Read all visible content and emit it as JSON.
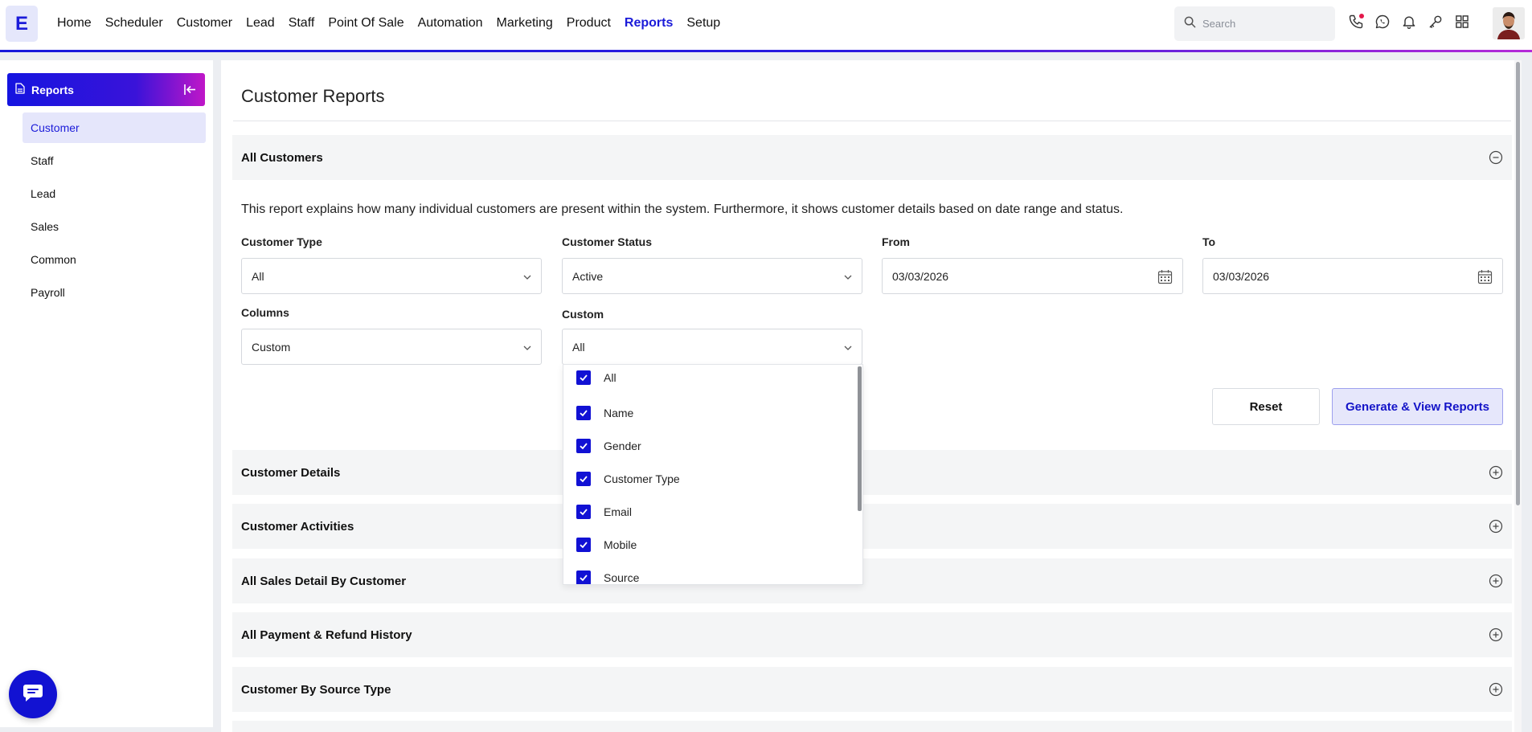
{
  "app": {
    "logo_letter": "E"
  },
  "nav": {
    "items": [
      {
        "label": "Home"
      },
      {
        "label": "Scheduler"
      },
      {
        "label": "Customer"
      },
      {
        "label": "Lead"
      },
      {
        "label": "Staff"
      },
      {
        "label": "Point Of Sale"
      },
      {
        "label": "Automation"
      },
      {
        "label": "Marketing"
      },
      {
        "label": "Product"
      },
      {
        "label": "Reports",
        "active": true
      },
      {
        "label": "Setup"
      }
    ]
  },
  "search": {
    "placeholder": "Search"
  },
  "top_icons": [
    "phone-icon",
    "whatsapp-icon",
    "bell-icon",
    "key-icon",
    "apps-grid-icon"
  ],
  "sidebar": {
    "title": "Reports",
    "items": [
      {
        "label": "Customer",
        "active": true
      },
      {
        "label": "Staff"
      },
      {
        "label": "Lead"
      },
      {
        "label": "Sales"
      },
      {
        "label": "Common"
      },
      {
        "label": "Payroll"
      }
    ]
  },
  "main": {
    "title": "Customer Reports",
    "section_open": "All Customers",
    "description": "This report explains how many individual customers are present within the system. Furthermore, it shows customer details based on date range and status.",
    "filters": {
      "customer_type": {
        "label": "Customer Type",
        "value": "All"
      },
      "customer_status": {
        "label": "Customer Status",
        "value": "Active"
      },
      "from": {
        "label": "From",
        "value": "03/03/2026"
      },
      "to": {
        "label": "To",
        "value": "03/03/2026"
      },
      "columns": {
        "label": "Columns",
        "value": "Custom"
      },
      "custom": {
        "label": "Custom",
        "value": "All"
      }
    },
    "custom_options": [
      "All",
      "Name",
      "Gender",
      "Customer Type",
      "Email",
      "Mobile",
      "Source"
    ],
    "buttons": {
      "reset": "Reset",
      "generate": "Generate & View Reports"
    },
    "sections": [
      "Customer Details",
      "Customer Activities",
      "All Sales Detail By Customer",
      "All Payment & Refund History",
      "Customer By Source Type"
    ]
  },
  "colors": {
    "accent": "#1b1bd9",
    "gradient_end": "#c016c8",
    "section_bg": "#f4f5f6"
  }
}
